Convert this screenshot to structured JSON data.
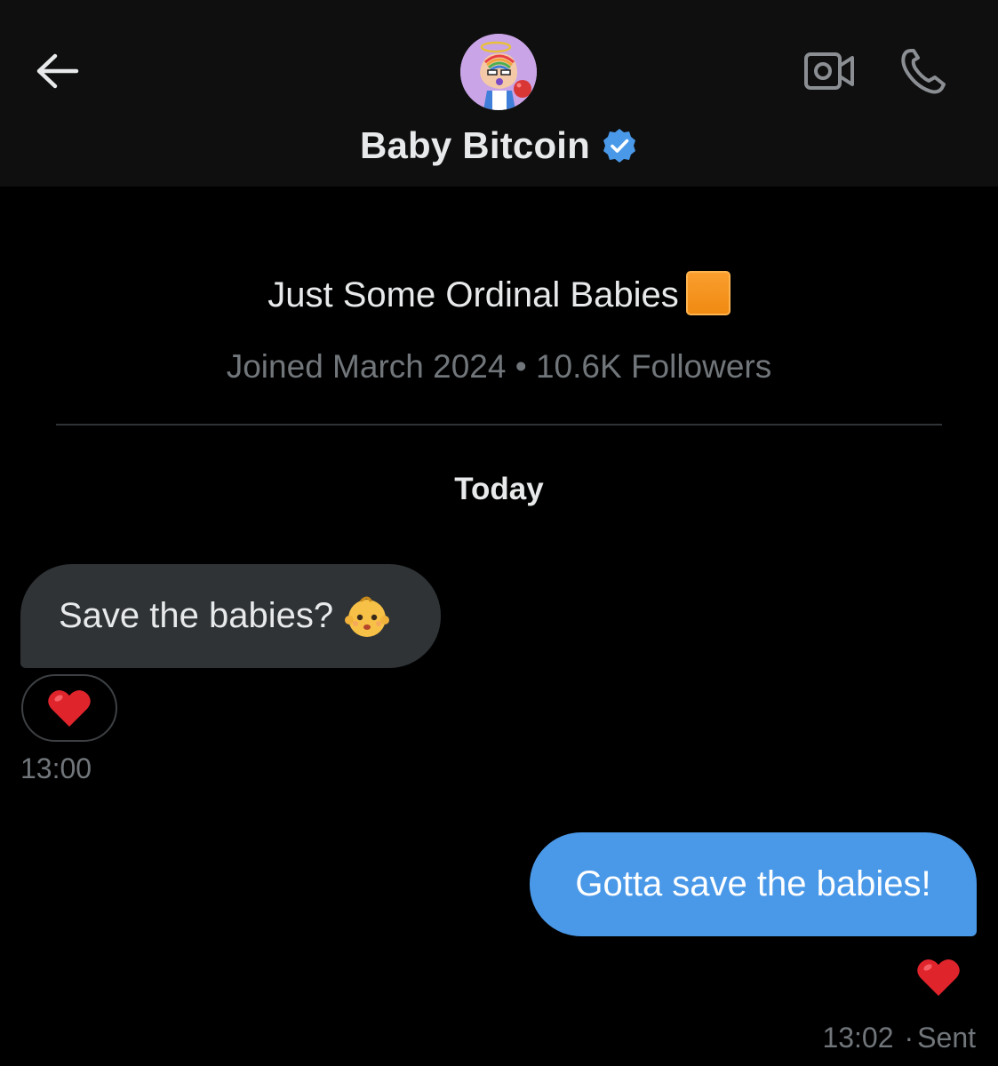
{
  "header": {
    "contact_name": "Baby Bitcoin",
    "verified": true,
    "back_icon": "arrow-left-icon",
    "video_icon": "video-camera-icon",
    "call_icon": "phone-icon",
    "verified_color": "#4a99e9"
  },
  "profile": {
    "bio": "Just Some Ordinal Babies",
    "bio_emoji": "orange-square-emoji",
    "joined": "Joined March 2024",
    "separator": "•",
    "followers": "10.6K Followers"
  },
  "conversation": {
    "date_label": "Today",
    "messages": [
      {
        "direction": "received",
        "text": "Save the babies?",
        "emoji": "baby-emoji",
        "reaction": "red-heart-emoji",
        "time": "13:00"
      },
      {
        "direction": "sent",
        "text": "Gotta save the babies!",
        "reaction": "red-heart-emoji",
        "time": "13:02",
        "status": "Sent"
      }
    ]
  },
  "colors": {
    "background": "#000000",
    "header_bg": "#0f0f0f",
    "received_bubble": "#2f3336",
    "sent_bubble": "#4a99e9",
    "muted_text": "#71767b",
    "primary_text": "#e7e9ea"
  }
}
